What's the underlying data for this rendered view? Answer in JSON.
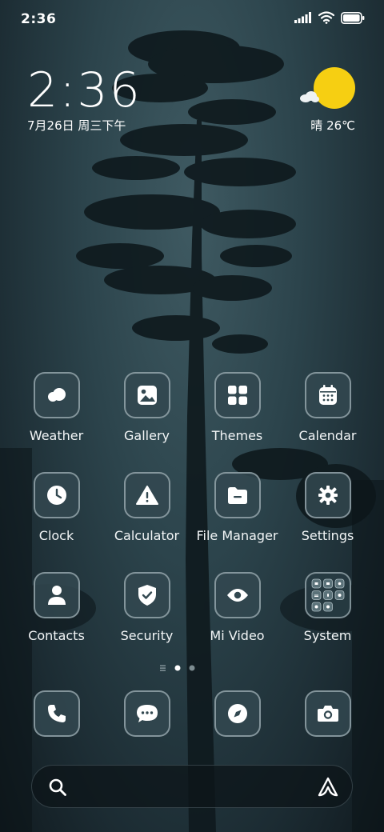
{
  "status_bar": {
    "time": "2:36",
    "icons": [
      "signal-icon",
      "wifi-icon",
      "battery-icon"
    ]
  },
  "clock_widget": {
    "time": "2:36",
    "date": "7月26日 周三下午"
  },
  "weather_widget": {
    "condition_temp": "晴 26℃",
    "icon": "sun-cloud-icon"
  },
  "apps": [
    {
      "label": "Weather",
      "icon": "weather-icon"
    },
    {
      "label": "Gallery",
      "icon": "gallery-icon"
    },
    {
      "label": "Themes",
      "icon": "themes-icon"
    },
    {
      "label": "Calendar",
      "icon": "calendar-icon"
    },
    {
      "label": "Clock",
      "icon": "clock-icon"
    },
    {
      "label": "Calculator",
      "icon": "calculator-icon"
    },
    {
      "label": "File Manager",
      "icon": "file-manager-icon"
    },
    {
      "label": "Settings",
      "icon": "settings-icon"
    },
    {
      "label": "Contacts",
      "icon": "contacts-icon"
    },
    {
      "label": "Security",
      "icon": "security-icon"
    },
    {
      "label": "Mi Video",
      "icon": "mi-video-icon"
    },
    {
      "label": "System",
      "icon": "system-folder-icon"
    }
  ],
  "page_indicator": {
    "pages": 2,
    "current": 1
  },
  "dock": [
    {
      "icon": "phone-icon"
    },
    {
      "icon": "messages-icon"
    },
    {
      "icon": "browser-icon"
    },
    {
      "icon": "camera-icon"
    }
  ],
  "search_bar": {
    "left_icon": "search-icon",
    "right_icon": "assistant-icon"
  },
  "colors": {
    "accent_sun": "#f6cf12",
    "icon_fill": "#324850",
    "icon_border": "#c8d7dc"
  }
}
